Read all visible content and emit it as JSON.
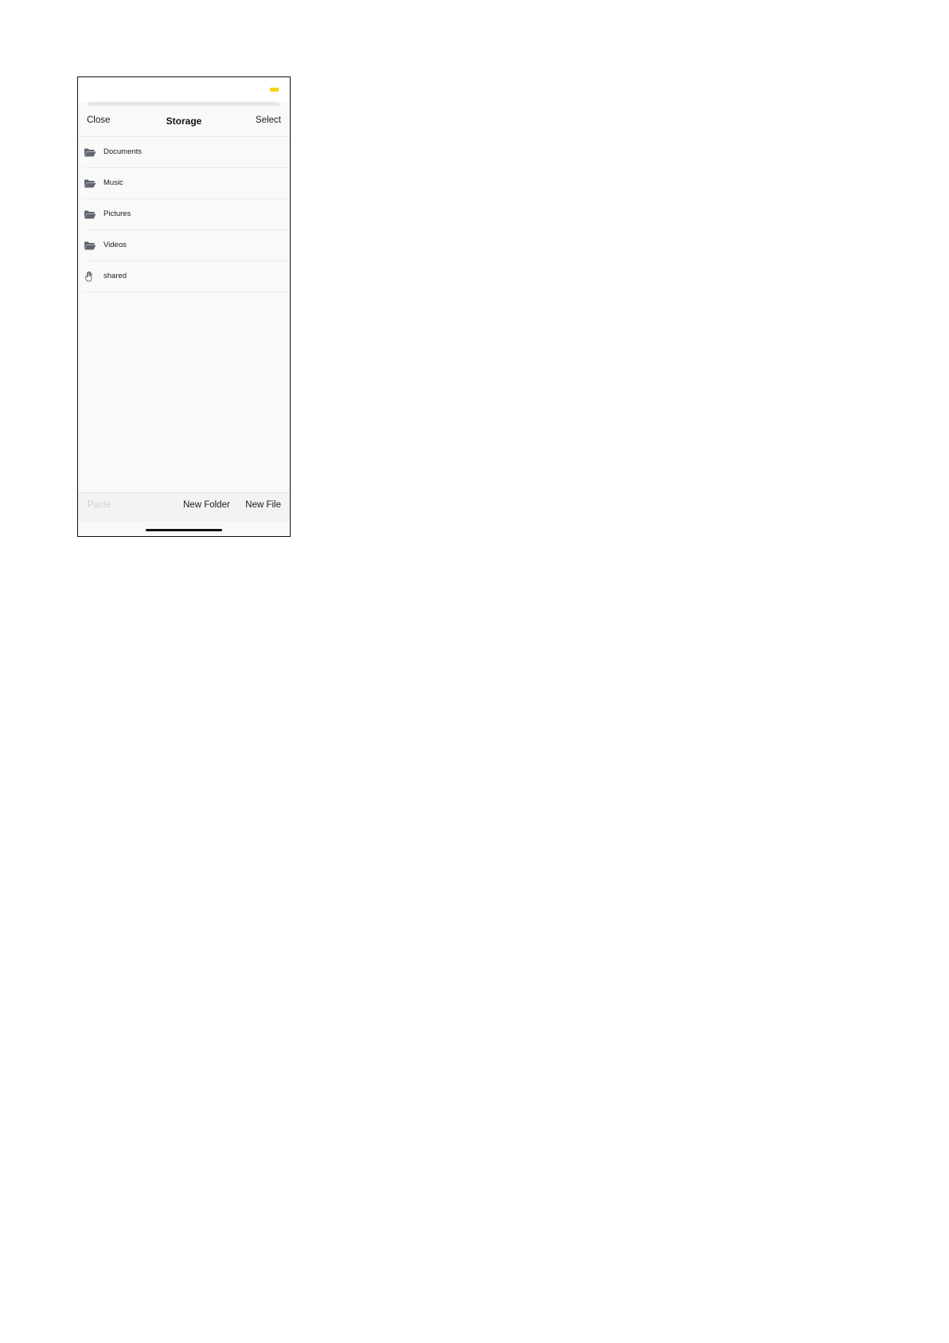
{
  "status_bar": {
    "battery_color": "#f5d314"
  },
  "nav": {
    "close_label": "Close",
    "title": "Storage",
    "select_label": "Select"
  },
  "files": [
    {
      "label": "Documents",
      "icon": "folder-icon"
    },
    {
      "label": "Music",
      "icon": "folder-icon"
    },
    {
      "label": "Pictures",
      "icon": "folder-icon"
    },
    {
      "label": "Videos",
      "icon": "folder-icon"
    },
    {
      "label": "shared",
      "icon": "hand-icon"
    }
  ],
  "toolbar": {
    "paste_label": "Paste",
    "new_folder_label": "New Folder",
    "new_file_label": "New File"
  },
  "colors": {
    "folder_icon": "#5f6670",
    "disabled_text": "#cfcfcf"
  }
}
